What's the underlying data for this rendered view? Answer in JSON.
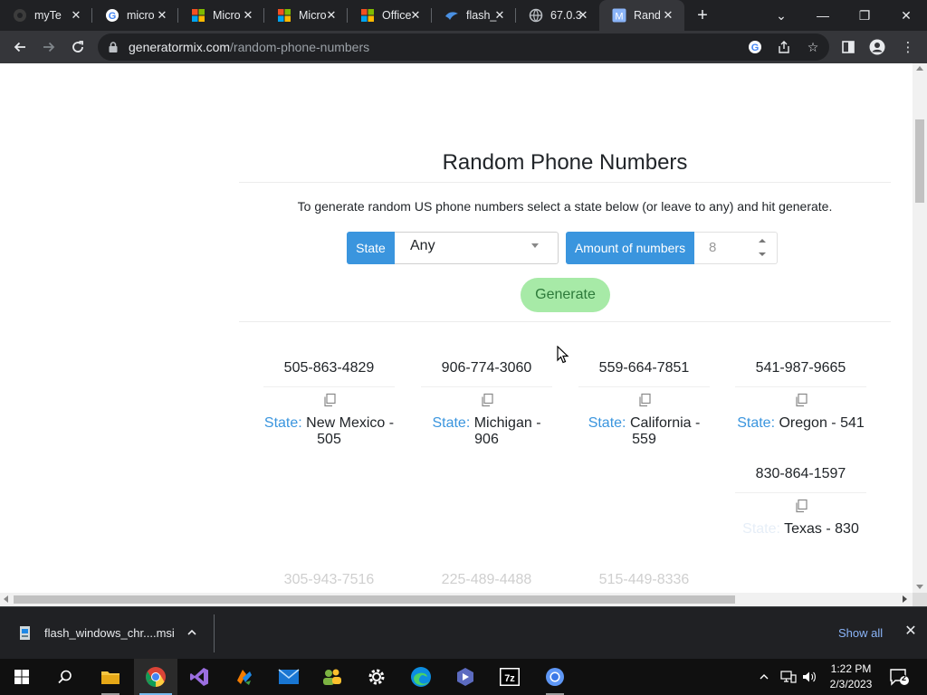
{
  "browser": {
    "tabs": [
      {
        "title": "myTe",
        "icon": "dark-circle-icon"
      },
      {
        "title": "micro",
        "icon": "google-icon"
      },
      {
        "title": "Micro",
        "icon": "microsoft-icon"
      },
      {
        "title": "Micro",
        "icon": "microsoft-icon"
      },
      {
        "title": "Office",
        "icon": "microsoft-icon"
      },
      {
        "title": "flash_",
        "icon": "flash-icon"
      },
      {
        "title": "67.0.3",
        "icon": "globe-icon"
      },
      {
        "title": "Rand",
        "icon": "m-icon",
        "active": true
      }
    ],
    "url_host": "generatormix.com",
    "url_path": "/random-phone-numbers"
  },
  "page": {
    "title": "Random Phone Numbers",
    "description": "To generate random US phone numbers select a state below (or leave to any) and hit generate.",
    "state_label": "State",
    "state_value": "Any",
    "amount_label": "Amount of numbers",
    "amount_value": "8",
    "generate_label": "Generate",
    "state_key": "State:",
    "results": [
      {
        "number": "505-863-4829",
        "state_line1": "New Mexico -",
        "state_line2": "505"
      },
      {
        "number": "906-774-3060",
        "state_line1": "Michigan -",
        "state_line2": "906"
      },
      {
        "number": "559-664-7851",
        "state_line1": "California -",
        "state_line2": "559"
      },
      {
        "number": "541-987-9665",
        "state_line1": "Oregon - 541",
        "state_line2": ""
      },
      {
        "number": "830-864-1597",
        "state_line1": "Texas - 830",
        "state_line2": ""
      },
      {
        "number": "305-943-7516"
      },
      {
        "number": "225-489-4488"
      },
      {
        "number": "515-449-8336"
      }
    ]
  },
  "download": {
    "filename": "flash_windows_chr....msi",
    "show_all": "Show all"
  },
  "taskbar": {
    "time": "1:22 PM",
    "date": "2/3/2023",
    "notifications": "2"
  }
}
